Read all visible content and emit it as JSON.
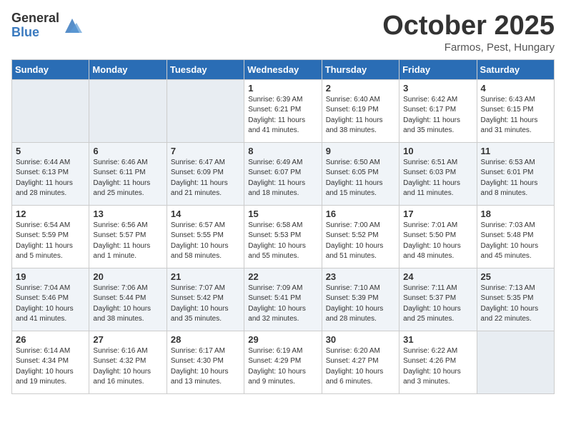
{
  "logo": {
    "general": "General",
    "blue": "Blue"
  },
  "title": "October 2025",
  "location": "Farmos, Pest, Hungary",
  "days_header": [
    "Sunday",
    "Monday",
    "Tuesday",
    "Wednesday",
    "Thursday",
    "Friday",
    "Saturday"
  ],
  "weeks": [
    [
      {
        "day": "",
        "info": ""
      },
      {
        "day": "",
        "info": ""
      },
      {
        "day": "",
        "info": ""
      },
      {
        "day": "1",
        "info": "Sunrise: 6:39 AM\nSunset: 6:21 PM\nDaylight: 11 hours\nand 41 minutes."
      },
      {
        "day": "2",
        "info": "Sunrise: 6:40 AM\nSunset: 6:19 PM\nDaylight: 11 hours\nand 38 minutes."
      },
      {
        "day": "3",
        "info": "Sunrise: 6:42 AM\nSunset: 6:17 PM\nDaylight: 11 hours\nand 35 minutes."
      },
      {
        "day": "4",
        "info": "Sunrise: 6:43 AM\nSunset: 6:15 PM\nDaylight: 11 hours\nand 31 minutes."
      }
    ],
    [
      {
        "day": "5",
        "info": "Sunrise: 6:44 AM\nSunset: 6:13 PM\nDaylight: 11 hours\nand 28 minutes."
      },
      {
        "day": "6",
        "info": "Sunrise: 6:46 AM\nSunset: 6:11 PM\nDaylight: 11 hours\nand 25 minutes."
      },
      {
        "day": "7",
        "info": "Sunrise: 6:47 AM\nSunset: 6:09 PM\nDaylight: 11 hours\nand 21 minutes."
      },
      {
        "day": "8",
        "info": "Sunrise: 6:49 AM\nSunset: 6:07 PM\nDaylight: 11 hours\nand 18 minutes."
      },
      {
        "day": "9",
        "info": "Sunrise: 6:50 AM\nSunset: 6:05 PM\nDaylight: 11 hours\nand 15 minutes."
      },
      {
        "day": "10",
        "info": "Sunrise: 6:51 AM\nSunset: 6:03 PM\nDaylight: 11 hours\nand 11 minutes."
      },
      {
        "day": "11",
        "info": "Sunrise: 6:53 AM\nSunset: 6:01 PM\nDaylight: 11 hours\nand 8 minutes."
      }
    ],
    [
      {
        "day": "12",
        "info": "Sunrise: 6:54 AM\nSunset: 5:59 PM\nDaylight: 11 hours\nand 5 minutes."
      },
      {
        "day": "13",
        "info": "Sunrise: 6:56 AM\nSunset: 5:57 PM\nDaylight: 11 hours\nand 1 minute."
      },
      {
        "day": "14",
        "info": "Sunrise: 6:57 AM\nSunset: 5:55 PM\nDaylight: 10 hours\nand 58 minutes."
      },
      {
        "day": "15",
        "info": "Sunrise: 6:58 AM\nSunset: 5:53 PM\nDaylight: 10 hours\nand 55 minutes."
      },
      {
        "day": "16",
        "info": "Sunrise: 7:00 AM\nSunset: 5:52 PM\nDaylight: 10 hours\nand 51 minutes."
      },
      {
        "day": "17",
        "info": "Sunrise: 7:01 AM\nSunset: 5:50 PM\nDaylight: 10 hours\nand 48 minutes."
      },
      {
        "day": "18",
        "info": "Sunrise: 7:03 AM\nSunset: 5:48 PM\nDaylight: 10 hours\nand 45 minutes."
      }
    ],
    [
      {
        "day": "19",
        "info": "Sunrise: 7:04 AM\nSunset: 5:46 PM\nDaylight: 10 hours\nand 41 minutes."
      },
      {
        "day": "20",
        "info": "Sunrise: 7:06 AM\nSunset: 5:44 PM\nDaylight: 10 hours\nand 38 minutes."
      },
      {
        "day": "21",
        "info": "Sunrise: 7:07 AM\nSunset: 5:42 PM\nDaylight: 10 hours\nand 35 minutes."
      },
      {
        "day": "22",
        "info": "Sunrise: 7:09 AM\nSunset: 5:41 PM\nDaylight: 10 hours\nand 32 minutes."
      },
      {
        "day": "23",
        "info": "Sunrise: 7:10 AM\nSunset: 5:39 PM\nDaylight: 10 hours\nand 28 minutes."
      },
      {
        "day": "24",
        "info": "Sunrise: 7:11 AM\nSunset: 5:37 PM\nDaylight: 10 hours\nand 25 minutes."
      },
      {
        "day": "25",
        "info": "Sunrise: 7:13 AM\nSunset: 5:35 PM\nDaylight: 10 hours\nand 22 minutes."
      }
    ],
    [
      {
        "day": "26",
        "info": "Sunrise: 6:14 AM\nSunset: 4:34 PM\nDaylight: 10 hours\nand 19 minutes."
      },
      {
        "day": "27",
        "info": "Sunrise: 6:16 AM\nSunset: 4:32 PM\nDaylight: 10 hours\nand 16 minutes."
      },
      {
        "day": "28",
        "info": "Sunrise: 6:17 AM\nSunset: 4:30 PM\nDaylight: 10 hours\nand 13 minutes."
      },
      {
        "day": "29",
        "info": "Sunrise: 6:19 AM\nSunset: 4:29 PM\nDaylight: 10 hours\nand 9 minutes."
      },
      {
        "day": "30",
        "info": "Sunrise: 6:20 AM\nSunset: 4:27 PM\nDaylight: 10 hours\nand 6 minutes."
      },
      {
        "day": "31",
        "info": "Sunrise: 6:22 AM\nSunset: 4:26 PM\nDaylight: 10 hours\nand 3 minutes."
      },
      {
        "day": "",
        "info": ""
      }
    ]
  ]
}
